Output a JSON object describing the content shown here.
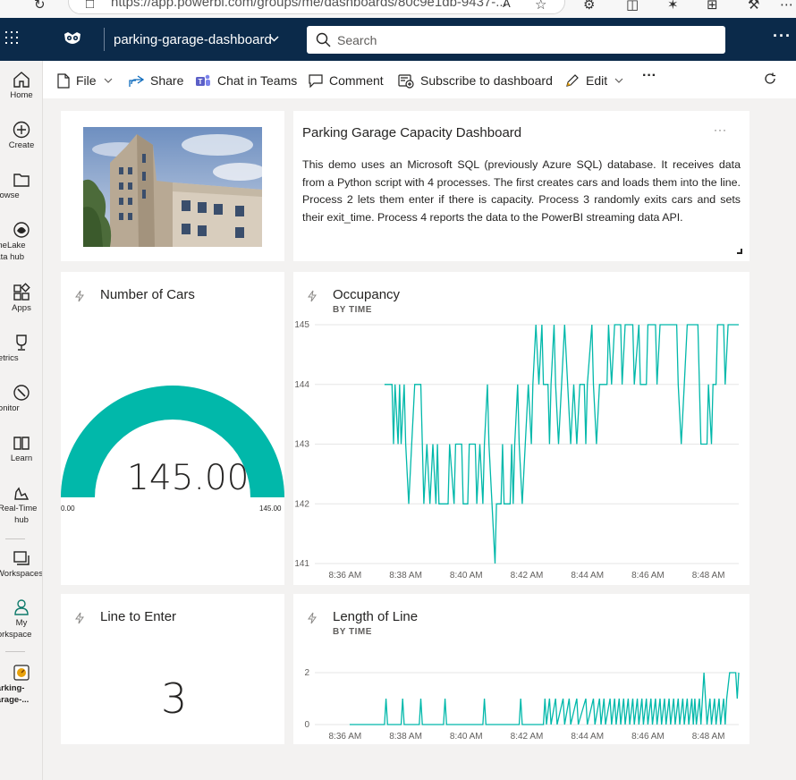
{
  "browser": {
    "url": "https://app.powerbi.com/groups/me/dashboards/80c9e1db-9437-...",
    "read_aloud": "À"
  },
  "header": {
    "workspace_title": "parking-garage-dashboard",
    "search_placeholder": "Search",
    "bg_color": "#0b2a4a"
  },
  "nav": {
    "items": [
      {
        "label": "Home",
        "icon": "home-icon"
      },
      {
        "label": "Create",
        "icon": "create-icon"
      },
      {
        "label": "Browse",
        "icon": "browse-icon"
      },
      {
        "label": "OneLake",
        "label2": "data hub",
        "icon": "onelake-icon"
      },
      {
        "label": "Apps",
        "icon": "apps-icon"
      },
      {
        "label": "Metrics",
        "icon": "metrics-icon"
      },
      {
        "label": "Monitor",
        "icon": "monitor-icon"
      },
      {
        "label": "Learn",
        "icon": "learn-icon"
      },
      {
        "label": "Real-Time",
        "label2": "hub",
        "icon": "realtime-hub-icon"
      },
      {
        "label": "Workspaces",
        "icon": "workspaces-icon"
      },
      {
        "label": "My",
        "label2": "workspace",
        "icon": "my-workspace-icon"
      },
      {
        "label": "parking-",
        "label2": "garage-...",
        "icon": "dashboard-icon"
      }
    ]
  },
  "toolbar": {
    "file": "File",
    "share": "Share",
    "chat": "Chat in Teams",
    "comment": "Comment",
    "subscribe": "Subscribe to dashboard",
    "edit": "Edit",
    "more": "···"
  },
  "tiles": {
    "text": {
      "title": "Parking Garage Capacity Dashboard",
      "body": "This demo uses an Microsoft SQL (previously Azure SQL) database. It receives data from a Python script with 4 processes. The first creates cars and loads them into the line. Process 2 lets them enter if there is capacity. Process 3 randomly exits cars and sets their exit_time. Process 4 reports the data to the PowerBI streaming data API.",
      "more": "···"
    },
    "cars": {
      "title": "Number of Cars",
      "value": "145.00",
      "min": "0.00",
      "max": "145.00",
      "fraction": 1.0,
      "color": "#01b8aa"
    },
    "line": {
      "title": "Line to Enter",
      "value": "3"
    },
    "occupancy": {
      "title": "Occupancy",
      "subtitle": "BY TIME"
    },
    "length": {
      "title": "Length of Line",
      "subtitle": "BY TIME"
    }
  },
  "chart_data": [
    {
      "type": "line",
      "title": "Occupancy",
      "subtitle": "BY TIME",
      "color": "#01b8aa",
      "yticks": [
        141,
        142,
        143,
        144,
        145
      ],
      "ylim": [
        141,
        145
      ],
      "xticks": [
        "8:36 AM",
        "8:38 AM",
        "8:40 AM",
        "8:42 AM",
        "8:44 AM",
        "8:46 AM",
        "8:48 AM"
      ],
      "xlim": [
        35.0,
        49.0
      ],
      "grid": true,
      "points": [
        [
          37.3,
          144
        ],
        [
          37.55,
          144
        ],
        [
          37.6,
          143
        ],
        [
          37.65,
          144
        ],
        [
          37.75,
          143
        ],
        [
          37.8,
          144
        ],
        [
          37.85,
          143
        ],
        [
          37.95,
          144
        ],
        [
          38.0,
          143
        ],
        [
          38.1,
          142
        ],
        [
          38.2,
          143
        ],
        [
          38.3,
          144
        ],
        [
          38.5,
          144
        ],
        [
          38.55,
          143
        ],
        [
          38.6,
          142
        ],
        [
          38.7,
          143
        ],
        [
          38.8,
          142
        ],
        [
          38.9,
          143
        ],
        [
          39.0,
          142
        ],
        [
          39.05,
          143
        ],
        [
          39.1,
          142
        ],
        [
          39.4,
          142
        ],
        [
          39.45,
          143
        ],
        [
          39.6,
          142
        ],
        [
          39.65,
          143
        ],
        [
          39.85,
          143
        ],
        [
          39.9,
          142
        ],
        [
          40.05,
          142
        ],
        [
          40.1,
          143
        ],
        [
          40.3,
          143
        ],
        [
          40.35,
          142
        ],
        [
          40.45,
          143
        ],
        [
          40.55,
          142
        ],
        [
          40.6,
          143
        ],
        [
          40.7,
          144
        ],
        [
          40.75,
          143
        ],
        [
          40.85,
          142
        ],
        [
          40.95,
          141
        ],
        [
          41.0,
          142
        ],
        [
          41.15,
          142
        ],
        [
          41.2,
          143
        ],
        [
          41.25,
          142
        ],
        [
          41.45,
          142
        ],
        [
          41.5,
          143
        ],
        [
          41.55,
          142
        ],
        [
          41.6,
          143
        ],
        [
          41.7,
          144
        ],
        [
          41.75,
          143
        ],
        [
          41.85,
          142
        ],
        [
          41.95,
          143
        ],
        [
          42.05,
          144
        ],
        [
          42.15,
          143
        ],
        [
          42.2,
          144
        ],
        [
          42.3,
          145
        ],
        [
          42.4,
          144
        ],
        [
          42.5,
          145
        ],
        [
          42.55,
          144
        ],
        [
          42.7,
          144
        ],
        [
          42.75,
          143
        ],
        [
          42.8,
          144
        ],
        [
          42.9,
          145
        ],
        [
          42.95,
          144
        ],
        [
          43.05,
          143
        ],
        [
          43.15,
          144
        ],
        [
          43.25,
          145
        ],
        [
          43.35,
          144
        ],
        [
          43.45,
          143
        ],
        [
          43.55,
          144
        ],
        [
          43.65,
          143
        ],
        [
          43.75,
          144
        ],
        [
          43.9,
          144
        ],
        [
          43.95,
          143
        ],
        [
          44.0,
          144
        ],
        [
          44.15,
          145
        ],
        [
          44.2,
          144
        ],
        [
          44.3,
          143
        ],
        [
          44.4,
          144
        ],
        [
          44.65,
          144
        ],
        [
          44.7,
          145
        ],
        [
          44.8,
          144
        ],
        [
          44.9,
          145
        ],
        [
          45.1,
          145
        ],
        [
          45.15,
          144
        ],
        [
          45.25,
          145
        ],
        [
          45.5,
          145
        ],
        [
          45.55,
          144
        ],
        [
          45.7,
          145
        ],
        [
          45.75,
          144
        ],
        [
          45.95,
          144
        ],
        [
          46.0,
          145
        ],
        [
          46.25,
          145
        ],
        [
          46.3,
          144
        ],
        [
          46.4,
          145
        ],
        [
          46.95,
          145
        ],
        [
          47.0,
          144
        ],
        [
          47.1,
          143
        ],
        [
          47.2,
          144
        ],
        [
          47.3,
          145
        ],
        [
          47.65,
          145
        ],
        [
          47.7,
          144
        ],
        [
          47.75,
          143
        ],
        [
          47.95,
          143
        ],
        [
          48.0,
          144
        ],
        [
          48.1,
          143
        ],
        [
          48.15,
          144
        ],
        [
          48.25,
          144
        ],
        [
          48.3,
          145
        ],
        [
          48.5,
          145
        ],
        [
          48.55,
          144
        ],
        [
          48.65,
          145
        ],
        [
          49.0,
          145
        ]
      ]
    },
    {
      "type": "line",
      "title": "Length of Line",
      "subtitle": "BY TIME",
      "color": "#01b8aa",
      "yticks": [
        0,
        2
      ],
      "ylim": [
        0,
        2
      ],
      "xticks": [
        "8:36 AM",
        "8:38 AM",
        "8:40 AM",
        "8:42 AM",
        "8:44 AM",
        "8:46 AM",
        "8:48 AM"
      ],
      "xlim": [
        35.0,
        49.0
      ],
      "grid": true,
      "points": [
        [
          36.15,
          0
        ],
        [
          37.3,
          0
        ],
        [
          37.35,
          1
        ],
        [
          37.4,
          0
        ],
        [
          37.85,
          0
        ],
        [
          37.9,
          1
        ],
        [
          37.95,
          0
        ],
        [
          38.45,
          0
        ],
        [
          38.5,
          1
        ],
        [
          38.55,
          0
        ],
        [
          39.25,
          0
        ],
        [
          39.3,
          1
        ],
        [
          39.35,
          0
        ],
        [
          40.55,
          0
        ],
        [
          40.6,
          1
        ],
        [
          40.65,
          0
        ],
        [
          41.75,
          0
        ],
        [
          41.8,
          1
        ],
        [
          41.85,
          0
        ],
        [
          42.55,
          0
        ],
        [
          42.6,
          1
        ],
        [
          42.65,
          0
        ],
        [
          42.75,
          1
        ],
        [
          42.8,
          0
        ],
        [
          42.95,
          1
        ],
        [
          43.0,
          0
        ],
        [
          43.2,
          1
        ],
        [
          43.25,
          0
        ],
        [
          43.4,
          1
        ],
        [
          43.45,
          0
        ],
        [
          43.65,
          1
        ],
        [
          43.7,
          0
        ],
        [
          43.95,
          1
        ],
        [
          44.0,
          0
        ],
        [
          44.2,
          1
        ],
        [
          44.25,
          0
        ],
        [
          44.4,
          1
        ],
        [
          44.45,
          0
        ],
        [
          44.55,
          1
        ],
        [
          44.6,
          0
        ],
        [
          44.75,
          1
        ],
        [
          44.8,
          0
        ],
        [
          44.9,
          1
        ],
        [
          44.95,
          0
        ],
        [
          45.05,
          1
        ],
        [
          45.1,
          0
        ],
        [
          45.2,
          1
        ],
        [
          45.25,
          0
        ],
        [
          45.35,
          1
        ],
        [
          45.4,
          0
        ],
        [
          45.5,
          1
        ],
        [
          45.55,
          0
        ],
        [
          45.65,
          1
        ],
        [
          45.7,
          0
        ],
        [
          45.8,
          1
        ],
        [
          45.85,
          0
        ],
        [
          45.95,
          1
        ],
        [
          46.0,
          0
        ],
        [
          46.1,
          1
        ],
        [
          46.15,
          0
        ],
        [
          46.25,
          1
        ],
        [
          46.3,
          0
        ],
        [
          46.4,
          1
        ],
        [
          46.45,
          0
        ],
        [
          46.55,
          1
        ],
        [
          46.6,
          0
        ],
        [
          46.7,
          1
        ],
        [
          46.75,
          0
        ],
        [
          46.85,
          1
        ],
        [
          46.9,
          0
        ],
        [
          47.0,
          1
        ],
        [
          47.05,
          0
        ],
        [
          47.15,
          1
        ],
        [
          47.2,
          0
        ],
        [
          47.3,
          1
        ],
        [
          47.35,
          0
        ],
        [
          47.45,
          1
        ],
        [
          47.5,
          0
        ],
        [
          47.55,
          1
        ],
        [
          47.6,
          0
        ],
        [
          47.7,
          1
        ],
        [
          47.75,
          0
        ],
        [
          47.85,
          2
        ],
        [
          47.9,
          1
        ],
        [
          47.95,
          0
        ],
        [
          48.05,
          1
        ],
        [
          48.1,
          0
        ],
        [
          48.2,
          1
        ],
        [
          48.25,
          0
        ],
        [
          48.35,
          1
        ],
        [
          48.4,
          0
        ],
        [
          48.5,
          1
        ],
        [
          48.55,
          0
        ],
        [
          48.6,
          1
        ],
        [
          48.7,
          2
        ],
        [
          48.9,
          2
        ],
        [
          48.95,
          1
        ],
        [
          49.0,
          2
        ]
      ]
    }
  ]
}
